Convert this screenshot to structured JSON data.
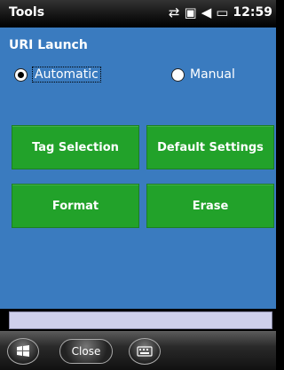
{
  "titlebar": {
    "title": "Tools",
    "time": "12:59",
    "icons": [
      "connectivity-arrows-icon",
      "no-sim-icon",
      "speaker-mute-icon",
      "battery-charging-icon"
    ]
  },
  "main": {
    "heading": "URI Launch",
    "radio": [
      {
        "label": "Automatic",
        "checked": true
      },
      {
        "label": "Manual",
        "checked": false
      }
    ],
    "buttons": {
      "tag_selection": "Tag Selection",
      "default_settings": "Default Settings",
      "format": "Format",
      "erase": "Erase"
    }
  },
  "softbar": {
    "close_label": "Close",
    "start_icon": "windows-start-icon",
    "keyboard_icon": "keyboard-icon"
  },
  "colors": {
    "background": "#3a7bbf",
    "button": "#22a22a",
    "input_strip": "#cfd0eb",
    "titlebar": "#000000"
  }
}
